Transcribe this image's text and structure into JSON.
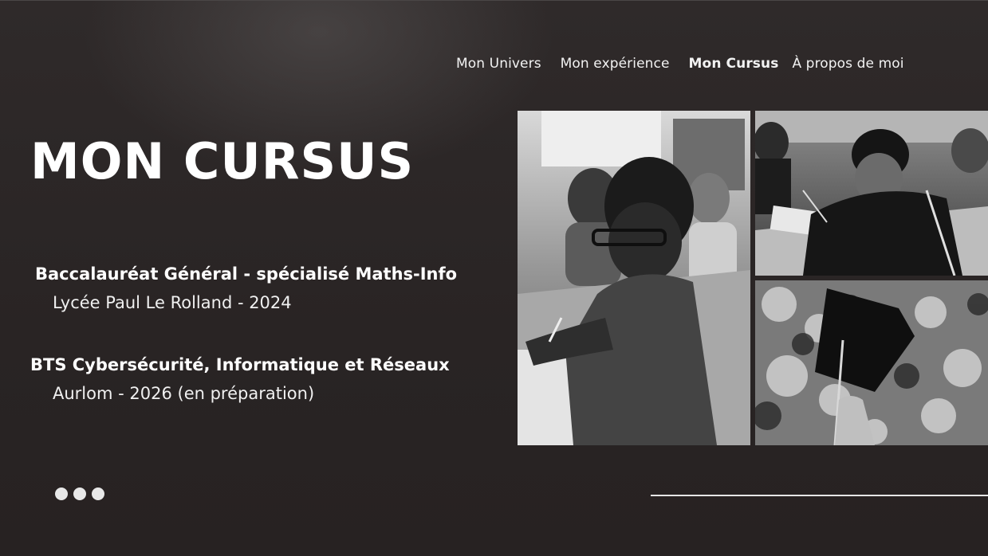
{
  "nav": {
    "items": [
      {
        "label": "Mon Univers"
      },
      {
        "label": "Mon expérience"
      },
      {
        "label": "Mon Cursus"
      },
      {
        "label": "À propos de moi"
      }
    ]
  },
  "page": {
    "title": "MON CURSUS"
  },
  "education": [
    {
      "degree": "Baccalauréat Général - spécialisé Maths-Info",
      "school": "Lycée Paul Le Rolland - 2024"
    },
    {
      "degree": "BTS Cybersécurité, Informatique et Réseaux",
      "school": "Aurlom - 2026 (en préparation)"
    }
  ],
  "photos": {
    "items": [
      {
        "icon": "photo-student-writing-classroom"
      },
      {
        "icon": "photo-student-exam-desk"
      },
      {
        "icon": "photo-graduation-cap-trees"
      }
    ]
  },
  "colors": {
    "background": "#2a2525",
    "text": "#ffffff",
    "accent": "#e8e8e8"
  }
}
